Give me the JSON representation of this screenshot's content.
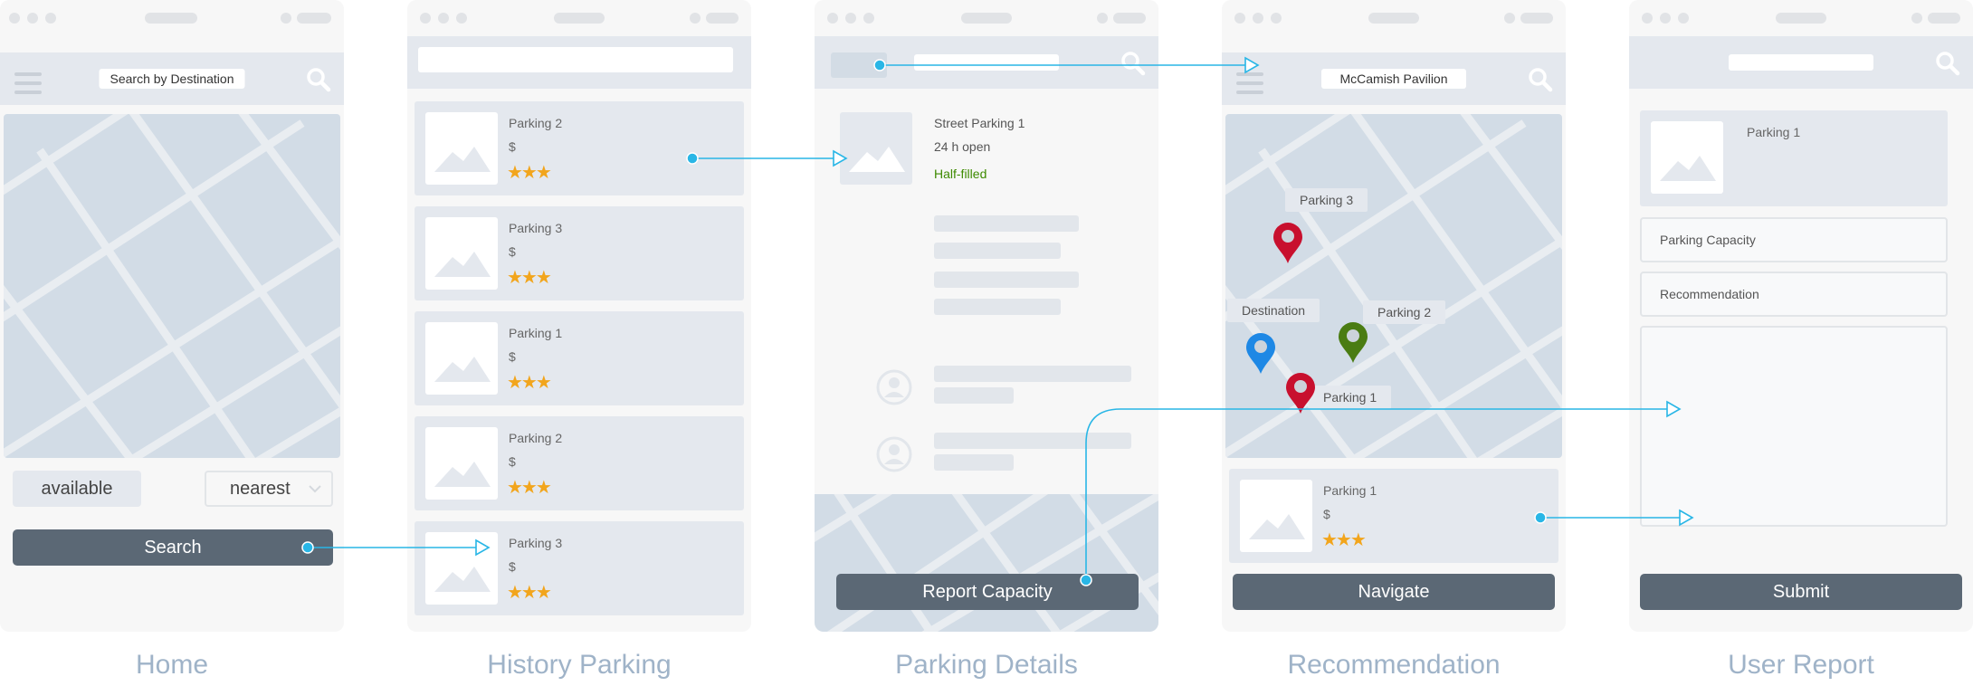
{
  "home": {
    "header_title": "Search by Destination",
    "filter_available": "available",
    "filter_nearest": "nearest",
    "search_button": "Search",
    "caption": "Home"
  },
  "history": {
    "caption": "History Parking",
    "items": [
      {
        "title": "Parking 2",
        "price": "$",
        "stars": "★★★"
      },
      {
        "title": "Parking 3",
        "price": "$",
        "stars": "★★★"
      },
      {
        "title": "Parking 1",
        "price": "$",
        "stars": "★★★"
      },
      {
        "title": "Parking 2",
        "price": "$",
        "stars": "★★★"
      },
      {
        "title": "Parking 3",
        "price": "$",
        "stars": "★★★"
      }
    ]
  },
  "details": {
    "title": "Street Parking 1",
    "hours": "24 h open",
    "status": "Half-filled",
    "status_color": "#3d8a00",
    "report_button": "Report Capacity",
    "caption": "Parking Details"
  },
  "recommendation": {
    "header_title": "McCamish Pavilion",
    "labels": {
      "parking3": "Parking 3",
      "destination": "Destination",
      "parking2": "Parking 2",
      "parking1": "Parking 1"
    },
    "card": {
      "title": "Parking 1",
      "price": "$",
      "stars": "★★★"
    },
    "navigate_button": "Navigate",
    "caption": "Recommendation"
  },
  "report": {
    "card_title": "Parking 1",
    "capacity_field": "Parking Capacity",
    "recommendation_field": "Recommendation",
    "submit_button": "Submit",
    "caption": "User Report"
  },
  "colors": {
    "connector": "#29b6e6",
    "pin_red": "#c8102e",
    "pin_blue": "#1e88e5",
    "pin_green": "#4a7c12",
    "star": "#f2a51c",
    "button": "#5b6875"
  },
  "icons": [
    "hamburger-icon",
    "search-icon",
    "image-placeholder-icon",
    "star-icon",
    "map-pin-icon",
    "user-avatar-icon",
    "chevron-down-icon"
  ]
}
